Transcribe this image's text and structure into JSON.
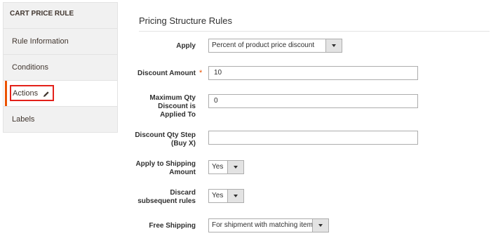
{
  "sidebar": {
    "title": "CART PRICE RULE",
    "items": [
      {
        "label": "Rule Information"
      },
      {
        "label": "Conditions"
      },
      {
        "label": "Actions"
      },
      {
        "label": "Labels"
      }
    ]
  },
  "main": {
    "section_title": "Pricing Structure Rules",
    "fields": {
      "apply": {
        "label": "Apply",
        "value": "Percent of product price discount"
      },
      "discount_amount": {
        "label": "Discount Amount",
        "value": "10",
        "required_mark": "*"
      },
      "max_qty": {
        "label_line1": "Maximum Qty",
        "label_line2": "Discount is",
        "label_line3": "Applied To",
        "value": "0"
      },
      "qty_step": {
        "label_line1": "Discount Qty Step",
        "label_line2": "(Buy X)",
        "value": ""
      },
      "apply_shipping": {
        "label_line1": "Apply to Shipping",
        "label_line2": "Amount",
        "value": "Yes"
      },
      "discard_rules": {
        "label_line1": "Discard",
        "label_line2": "subsequent rules",
        "value": "Yes"
      },
      "free_shipping": {
        "label": "Free Shipping",
        "value": "For shipment with matching items"
      }
    }
  },
  "colors": {
    "accent": "#eb5202",
    "highlight_box": "#e3211a",
    "sidebar_bg": "#f1f1f1"
  },
  "icons": {
    "active_tab": "pencil-icon",
    "select_arrow": "chevron-down-icon"
  }
}
